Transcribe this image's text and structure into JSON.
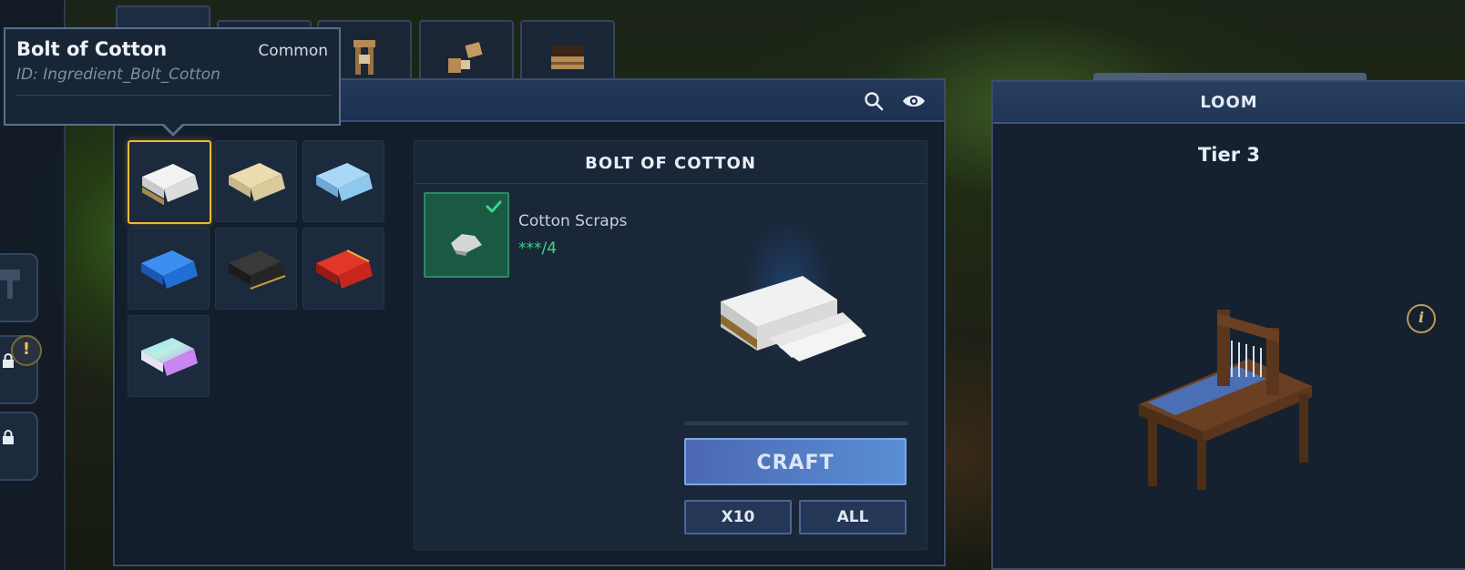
{
  "tooltip": {
    "name": "Bolt of Cotton",
    "rarity": "Common",
    "id": "ID: Ingredient_Bolt_Cotton"
  },
  "recipe": {
    "title": "BOLT OF COTTON",
    "ingredient": {
      "name": "Cotton Scraps",
      "count": "***/4",
      "status": "check-icon"
    }
  },
  "buttons": {
    "craft": "CRAFT",
    "x10": "X10",
    "all": "ALL"
  },
  "bench": {
    "name": "LOOM",
    "tier": "Tier 3",
    "info": "i"
  },
  "side": {
    "alert": "!"
  },
  "items": [
    {
      "icon": "white-cloth-bolt-icon",
      "color": "#e8e8e8"
    },
    {
      "icon": "cream-cloth-bolt-icon",
      "color": "#e6d8ad"
    },
    {
      "icon": "light-blue-cloth-bolt-icon",
      "color": "#8fc8ee"
    },
    {
      "icon": "blue-cloth-bolt-icon",
      "color": "#1f6fd6"
    },
    {
      "icon": "black-cloth-bolt-icon",
      "color": "#262424"
    },
    {
      "icon": "red-cloth-bolt-icon",
      "color": "#c8261d"
    },
    {
      "icon": "iridescent-cloth-bolt-icon",
      "color": "#9fe0ff"
    }
  ],
  "colors": {
    "accent_gold": "#f0b838",
    "ingredient_ok": "#3ad68a",
    "craft_blue": "#5a8fd4"
  }
}
